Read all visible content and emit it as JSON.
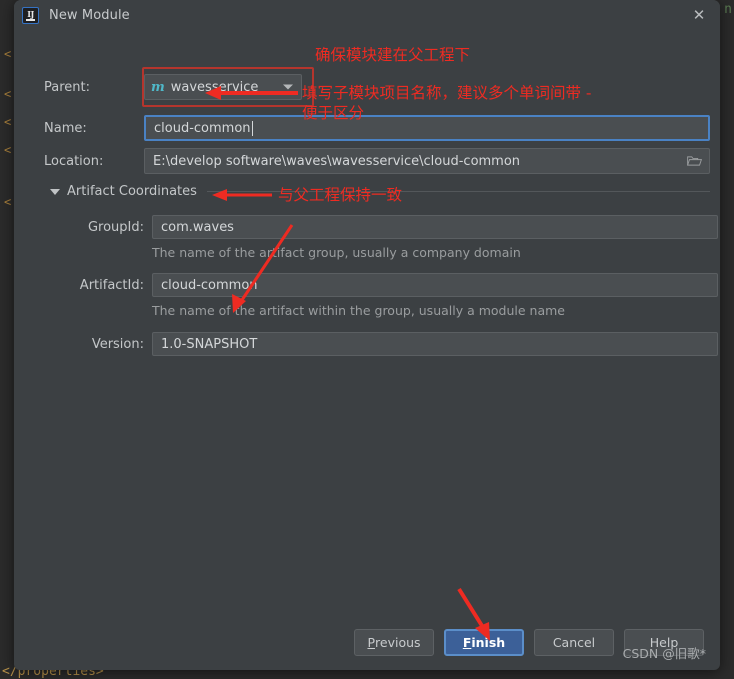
{
  "window": {
    "title": "New Module",
    "app_icon": "intellij-idea-icon",
    "app_icon_text": "IJ",
    "close_icon": "close-icon"
  },
  "backdrop": {
    "closing_tag": "</properties>",
    "right_fragment": "n",
    "bracket_glyph": "<"
  },
  "form": {
    "parent": {
      "label": "Parent:",
      "value": "wavesservice",
      "icon": "maven-module-icon",
      "icon_glyph": "m",
      "dropdown_icon": "chevron-down-icon"
    },
    "name": {
      "label": "Name:",
      "value": "cloud-common",
      "placeholder": ""
    },
    "location": {
      "label": "Location:",
      "value": "E:\\develop software\\waves\\wavesservice\\cloud-common",
      "placeholder": "",
      "browse_icon": "folder-icon"
    },
    "artifact_section": {
      "title": "Artifact Coordinates",
      "expanded": true,
      "toggle_icon": "triangle-down-icon"
    },
    "group_id": {
      "label": "GroupId:",
      "value": "com.waves",
      "helper": "The name of the artifact group, usually a company domain"
    },
    "artifact_id": {
      "label": "ArtifactId:",
      "value": "cloud-common",
      "helper": "The name of the artifact within the group, usually a module name"
    },
    "version": {
      "label": "Version:",
      "value": "1.0-SNAPSHOT",
      "helper": ""
    }
  },
  "buttons": {
    "previous": {
      "label": "Previous",
      "mnemonic": "P",
      "rest": "revious"
    },
    "finish": {
      "label": "Finish",
      "mnemonic": "F",
      "rest": "inish"
    },
    "cancel": {
      "label": "Cancel"
    },
    "help": {
      "label": "Help"
    }
  },
  "annotations": {
    "parent_note": "确保模块建在父工程下",
    "name_note_line1": "填写子模块项目名称，建议多个单词间带 -",
    "name_note_line2": "便于区分",
    "group_note": "与父工程保持一致",
    "arrow_to_name": "arrow-left-icon",
    "arrow_to_group": "arrow-left-icon",
    "arrow_to_version": "arrow-diagonal-icon",
    "arrow_to_finish": "arrow-down-icon",
    "parent_box": "red-highlight-box"
  },
  "watermark": {
    "text": "CSDN @旧歌*"
  },
  "colors": {
    "dialog_bg": "#3c4043",
    "field_bg": "#4a4e51",
    "accent_blue": "#4a82c4",
    "primary_button": "#3c6098",
    "annotation_red": "#ee2b22",
    "highlight_box_red": "#b5352d",
    "maven_icon_teal": "#4fb8c9",
    "xml_tag_orange": "#b8924a"
  }
}
